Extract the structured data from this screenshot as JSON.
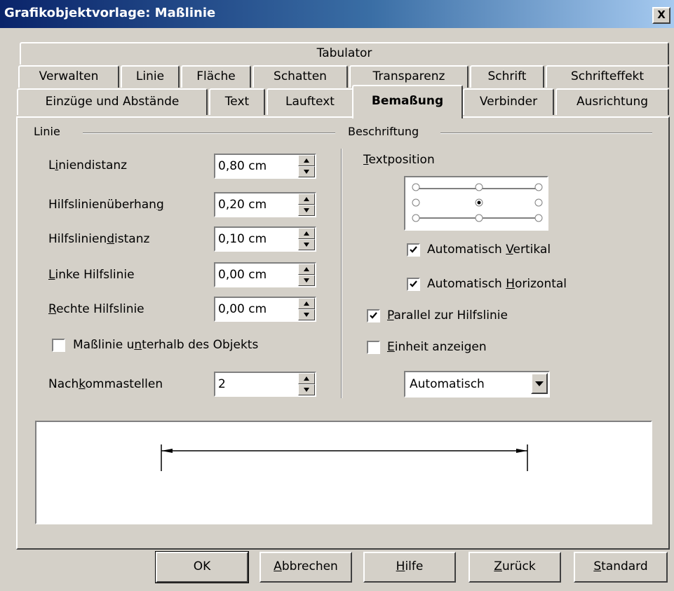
{
  "window": {
    "title": "Grafikobjektvorlage: Maßlinie",
    "close_label": "X"
  },
  "tabs": {
    "row1": [
      "Tabulator"
    ],
    "row2": [
      "Verwalten",
      "Linie",
      "Fläche",
      "Schatten",
      "Transparenz",
      "Schrift",
      "Schrifteffekt"
    ],
    "row3": [
      "Einzüge und Abstände",
      "Text",
      "Lauftext",
      "Bemaßung",
      "Verbinder",
      "Ausrichtung"
    ],
    "active": "Bemaßung"
  },
  "linie": {
    "heading": "Linie",
    "fields": [
      {
        "label_a": "L",
        "label_u": "i",
        "label_b": "niendistanz",
        "value": "0,80 cm"
      },
      {
        "label_a": "Hilfslinienüberhan",
        "label_u": "g",
        "label_b": "",
        "value": "0,20 cm"
      },
      {
        "label_a": "Hilfslinien",
        "label_u": "d",
        "label_b": "istanz",
        "value": "0,10 cm"
      },
      {
        "label_a": "",
        "label_u": "L",
        "label_b": "inke Hilfslinie",
        "value": "0,00 cm"
      },
      {
        "label_a": "",
        "label_u": "R",
        "label_b": "echte Hilfslinie",
        "value": "0,00 cm"
      }
    ],
    "below_checkbox": {
      "label_a": "Maßlinie u",
      "label_u": "n",
      "label_b": "terhalb des Objekts",
      "checked": false
    },
    "decimals": {
      "label_a": "Nach",
      "label_u": "k",
      "label_b": "ommastellen",
      "value": "2"
    }
  },
  "beschriftung": {
    "heading": "Beschriftung",
    "textposition": {
      "label_u": "T",
      "label_b": "extposition"
    },
    "auto_vertical": {
      "label_a": "Automatisch ",
      "label_u": "V",
      "label_b": "ertikal",
      "checked": true
    },
    "auto_horizontal": {
      "label_a": "Automatisch ",
      "label_u": "H",
      "label_b": "orizontal",
      "checked": true
    },
    "parallel": {
      "label_u": "P",
      "label_b": "arallel zur Hilfslinie",
      "checked": true
    },
    "show_unit": {
      "label_u": "E",
      "label_b": "inheit anzeigen",
      "checked": false
    },
    "unit_select": "Automatisch"
  },
  "buttons": {
    "ok": {
      "u": "",
      "b": "OK"
    },
    "cancel": {
      "u": "A",
      "b": "bbrechen"
    },
    "help": {
      "u": "H",
      "b": "ilfe"
    },
    "back": {
      "u": "Z",
      "b": "urück"
    },
    "default": {
      "u": "S",
      "b": "tandard"
    }
  }
}
